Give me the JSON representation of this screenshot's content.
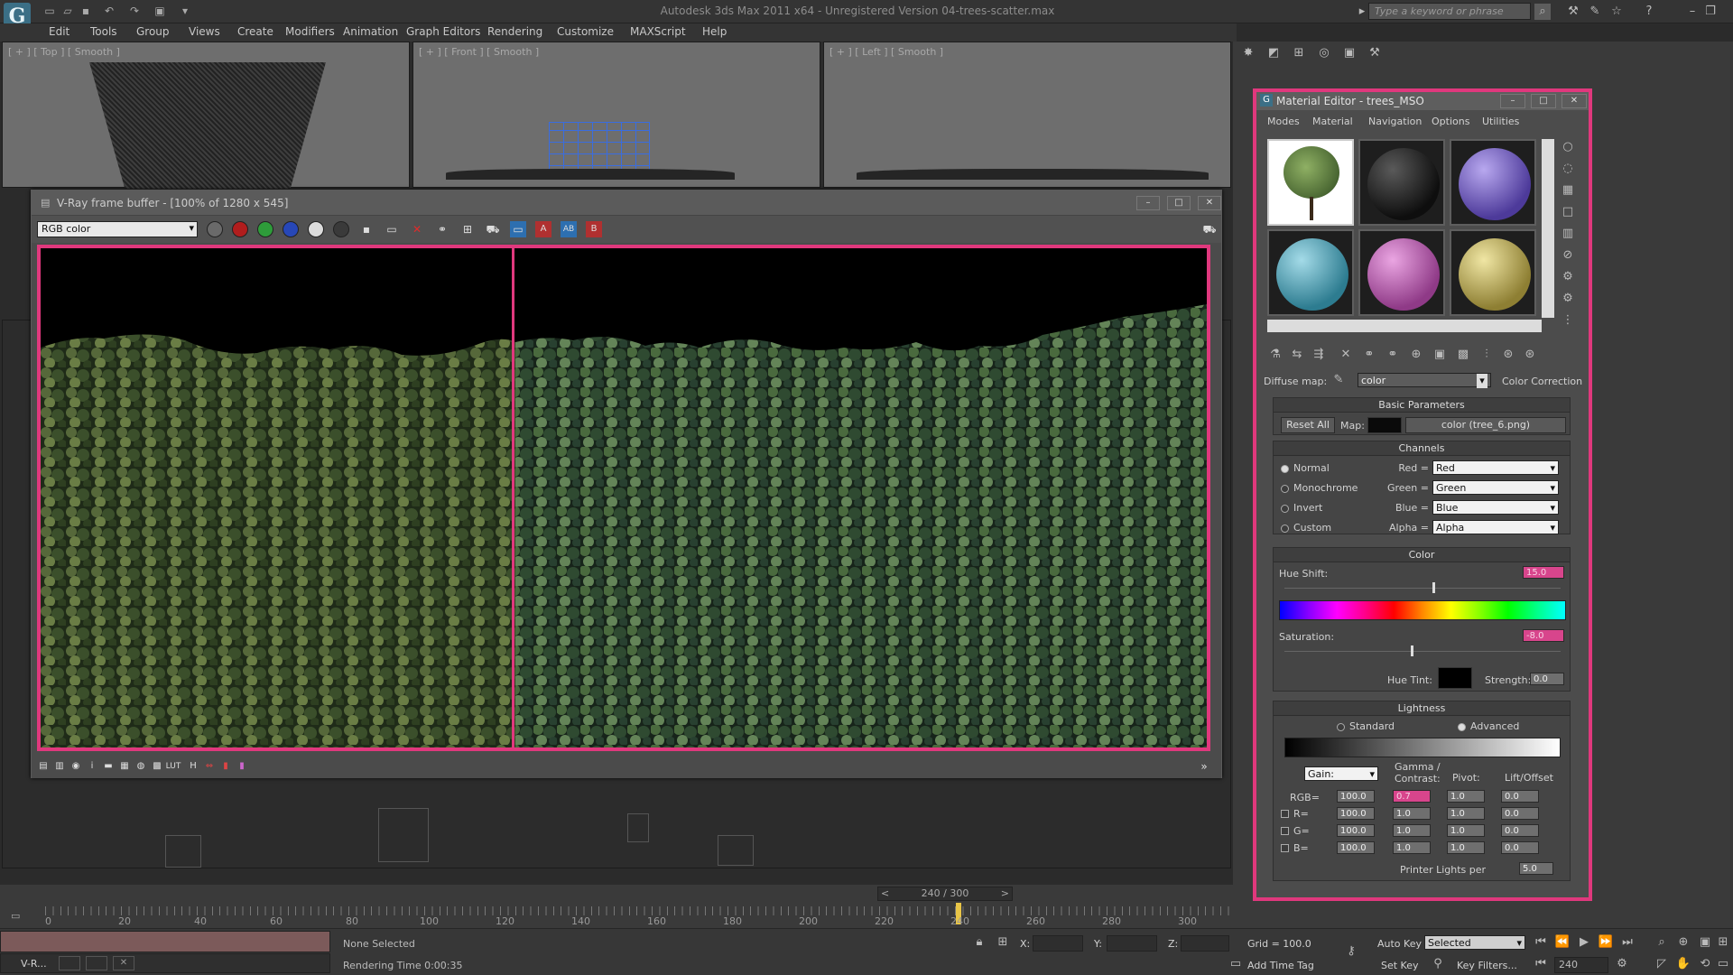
{
  "app": {
    "window_title": "Autodesk 3ds Max  2011 x64   -  Unregistered Version    04-trees-scatter.max",
    "search_placeholder": "Type a keyword or phrase",
    "logo_glyph": "G"
  },
  "menu": [
    "Edit",
    "Tools",
    "Group",
    "Views",
    "Create",
    "Modifiers",
    "Animation",
    "Graph Editors",
    "Rendering",
    "Customize",
    "MAXScript",
    "Help"
  ],
  "viewports": {
    "top_label": "[ + ] [ Top ] [ Smooth ]",
    "front_label": "[ + ] [ Front ] [ Smooth ]",
    "left_label": "[ + ] [ Left ] [ Smooth ]"
  },
  "vray": {
    "title": "V-Ray frame buffer - [100% of 1280 x 545]",
    "channel": "RGB color"
  },
  "material_editor": {
    "title": "Material Editor - trees_MSO",
    "menus": [
      "Modes",
      "Material",
      "Navigation",
      "Options",
      "Utilities"
    ],
    "diffuse_label": "Diffuse map:",
    "map_name": "color",
    "map_type": "Color Correction",
    "basic": {
      "header": "Basic Parameters",
      "reset": "Reset All",
      "map_label": "Map:",
      "map_file": "color (tree_6.png)"
    },
    "channels": {
      "header": "Channels",
      "modes": [
        "Normal",
        "Monochrome",
        "Invert",
        "Custom"
      ],
      "rows": [
        {
          "label": "Red =",
          "value": "Red"
        },
        {
          "label": "Green =",
          "value": "Green"
        },
        {
          "label": "Blue =",
          "value": "Blue"
        },
        {
          "label": "Alpha =",
          "value": "Alpha"
        }
      ]
    },
    "color": {
      "header": "Color",
      "hue_shift_label": "Hue Shift:",
      "hue_shift": "15.0",
      "saturation_label": "Saturation:",
      "saturation": "-8.0",
      "hue_tint_label": "Hue Tint:",
      "strength_label": "Strength:",
      "strength": "0.0"
    },
    "lightness": {
      "header": "Lightness",
      "standard": "Standard",
      "advanced": "Advanced",
      "gain": "Gain:",
      "gamma_col": "Gamma / Contrast:",
      "pivot_col": "Pivot:",
      "lift_col": "Lift/Offset",
      "rows": [
        {
          "label": "RGB=",
          "gain": "100.0",
          "gamma": "0.7",
          "pivot": "1.0",
          "lift": "0.0"
        },
        {
          "label": "R=",
          "gain": "100.0",
          "gamma": "1.0",
          "pivot": "1.0",
          "lift": "0.0"
        },
        {
          "label": "G=",
          "gain": "100.0",
          "gamma": "1.0",
          "pivot": "1.0",
          "lift": "0.0"
        },
        {
          "label": "B=",
          "gain": "100.0",
          "gamma": "1.0",
          "pivot": "1.0",
          "lift": "0.0"
        }
      ],
      "printer_label": "Printer Lights per",
      "printer_value": "5.0"
    }
  },
  "timeline": {
    "frame_label": "240 / 300",
    "ticks": [
      "0",
      "20",
      "40",
      "60",
      "80",
      "100",
      "120",
      "140",
      "160",
      "180",
      "200",
      "220",
      "240",
      "260",
      "280",
      "300"
    ]
  },
  "status": {
    "selection": "None Selected",
    "render_time": "Rendering Time  0:00:35",
    "x_label": "X:",
    "y_label": "Y:",
    "z_label": "Z:",
    "grid": "Grid = 100.0",
    "add_time_tag": "Add Time Tag",
    "auto_key": "Auto Key",
    "set_key": "Set Key",
    "selected": "Selected",
    "key_filters": "Key Filters...",
    "frame": "240",
    "maxscript_mini": "V-R..."
  }
}
